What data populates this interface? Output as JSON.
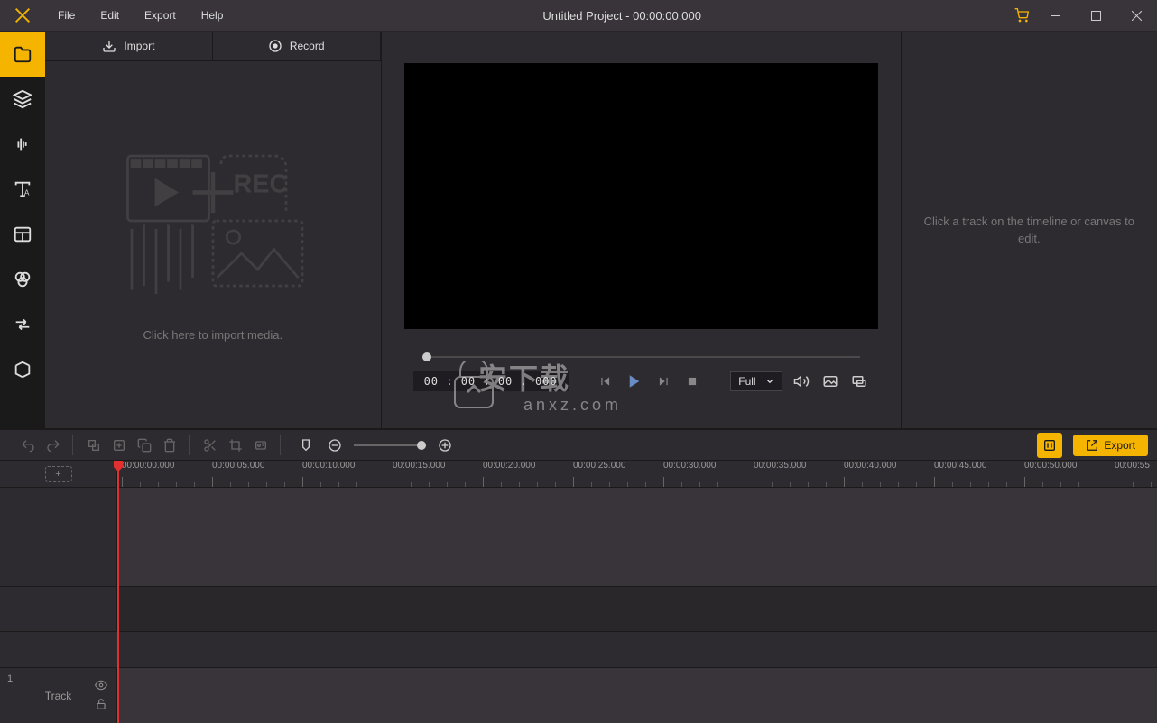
{
  "menu": {
    "file": "File",
    "edit": "Edit",
    "export": "Export",
    "help": "Help"
  },
  "title": "Untitled Project - 00:00:00.000",
  "media": {
    "import": "Import",
    "record": "Record",
    "hint": "Click here to import media."
  },
  "preview": {
    "timecode": "00 : 00 : 00 . 000",
    "quality": "Full"
  },
  "inspector": {
    "hint": "Click a track on the timeline or canvas to edit."
  },
  "toolbar": {
    "export_label": "Export"
  },
  "timeline": {
    "ticks": [
      "00:00:00.000",
      "00:00:05.000",
      "00:00:10.000",
      "00:00:15.000",
      "00:00:20.000",
      "00:00:25.000",
      "00:00:30.000",
      "00:00:35.000",
      "00:00:40.000",
      "00:00:45.000",
      "00:00:50.000",
      "00:00:55"
    ],
    "track_num": "1",
    "track_label": "Track"
  },
  "watermark": {
    "main": "安下载",
    "sub": "anxz.com"
  }
}
